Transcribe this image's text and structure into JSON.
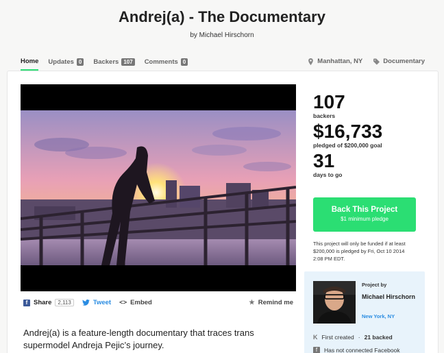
{
  "project": {
    "title": "Andrej(a) - The Documentary",
    "byline": "by Michael Hirschorn"
  },
  "tabs": [
    {
      "label": "Home",
      "badge": null
    },
    {
      "label": "Updates",
      "badge": "0"
    },
    {
      "label": "Backers",
      "badge": "107"
    },
    {
      "label": "Comments",
      "badge": "0"
    }
  ],
  "meta": {
    "location": "Manhattan, NY",
    "category": "Documentary"
  },
  "share": {
    "share_label": "Share",
    "share_count": "2,113",
    "tweet_label": "Tweet",
    "embed_label": "Embed",
    "remind_label": "Remind me"
  },
  "description": "Andrej(a) is a feature-length documentary that traces trans supermodel Andreja Pejic’s journey.",
  "stats": {
    "backers_count": "107",
    "backers_label": "backers",
    "pledged_amount": "$16,733",
    "pledged_label": "pledged of $200,000 goal",
    "days_count": "31",
    "days_label": "days to go"
  },
  "cta": {
    "label": "Back This Project",
    "sublabel": "$1 minimum pledge"
  },
  "funding_note": "This project will only be funded if at least $200,000 is pledged by Fri, Oct 10 2014 2:08 PM EDT.",
  "creator": {
    "project_by_label": "Project by",
    "name": "Michael Hirschorn",
    "location": "New York, NY",
    "created_text": "First created",
    "backed_text": "21 backed",
    "facebook_text": "Has not connected Facebook"
  },
  "colors": {
    "accent": "#2bde73",
    "link": "#2a8ce2",
    "facebook": "#3b5998"
  }
}
